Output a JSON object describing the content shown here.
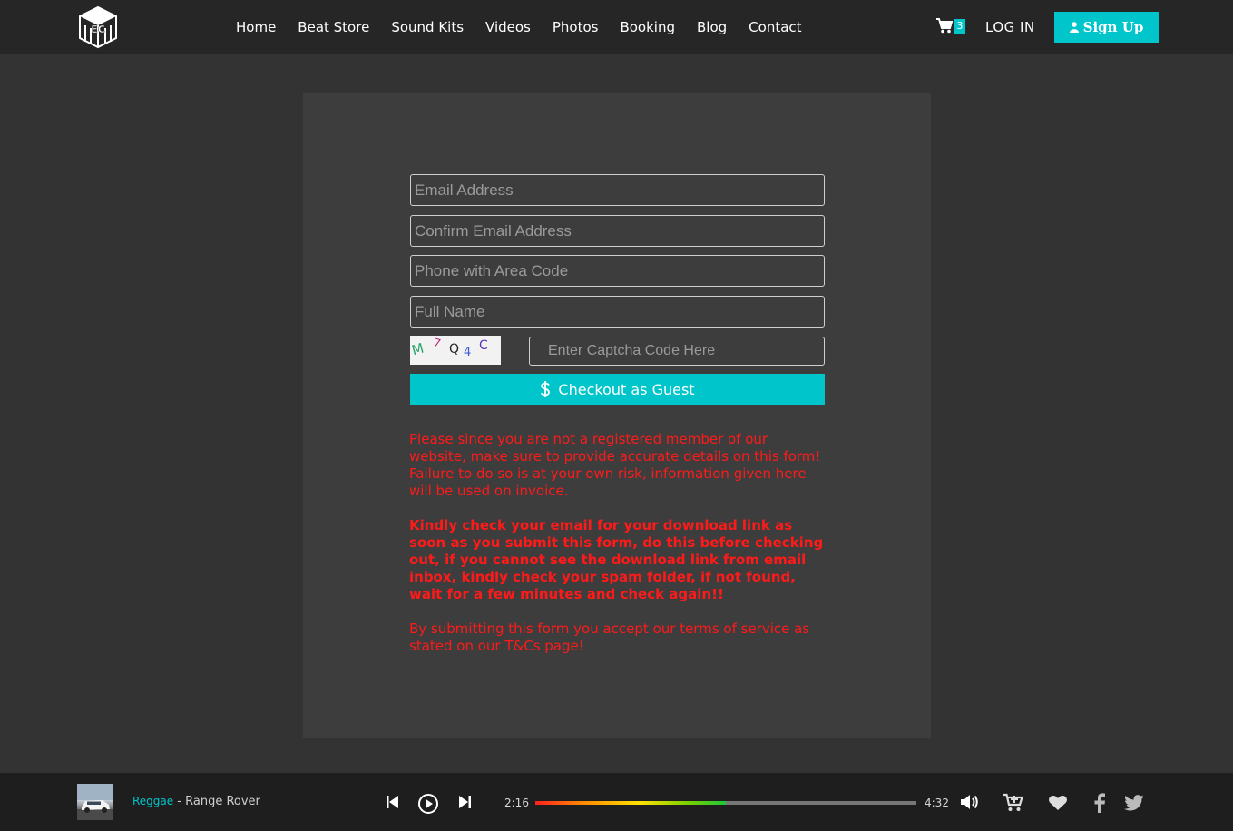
{
  "header": {
    "nav": [
      "Home",
      "Beat Store",
      "Sound Kits",
      "Videos",
      "Photos",
      "Booking",
      "Blog",
      "Contact"
    ],
    "cart_count": "3",
    "login_label": "LOG IN",
    "signup_label": "Sign Up",
    "logo_text": "EC"
  },
  "form": {
    "email_placeholder": "Email Address",
    "confirm_email_placeholder": "Confirm Email Address",
    "phone_placeholder": "Phone with Area Code",
    "name_placeholder": "Full Name",
    "captcha_chars": [
      "M",
      "7",
      "Q",
      "4",
      "C"
    ],
    "captcha_placeholder": "Enter Captcha Code Here",
    "checkout_label": "Checkout as Guest"
  },
  "notes": {
    "warning": "Please since you are not a registered member of our website, make sure to provide accurate details on this form! Failure to do so is at your own risk, information given here will be used on invoice.",
    "email_notice": "Kindly check your email for your download link as soon as you submit this form, do this before checking out, if you cannot see the download link from email inbox, kindly check your spam folder, if not found, wait for a few minutes and check again!!",
    "terms": "By submitting this form you accept our terms of service as stated on our T&Cs page!"
  },
  "player": {
    "genre": "Reggae",
    "title": "Range Rover",
    "elapsed": "2:16",
    "duration": "4:32",
    "progress_fraction": 0.5
  },
  "colors": {
    "accent": "#00c6cc",
    "warning_text": "#ff1a1a",
    "background": "#333333",
    "card": "#3d3d3d",
    "header": "#262626"
  }
}
